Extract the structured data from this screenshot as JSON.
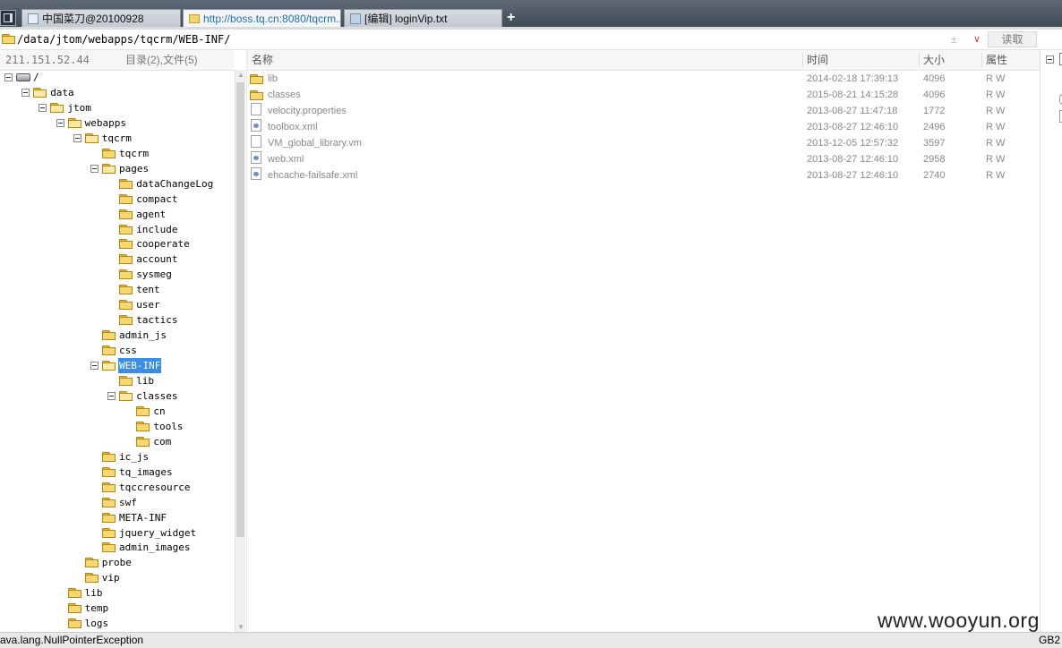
{
  "tabs": [
    {
      "title": "中国菜刀@20100928",
      "icon": "page-icon",
      "active": false
    },
    {
      "title": "http://boss.tq.cn:8080/tqcrm...",
      "icon": "folder-icon",
      "active": true
    },
    {
      "title": "[编辑] loginVip.txt",
      "icon": "document-icon",
      "active": false
    }
  ],
  "new_tab_label": "+",
  "path_bar": {
    "path": "/data/jtom/webapps/tqcrm/WEB-INF/",
    "combo_value": "±",
    "combo_arrow": "∨",
    "read_button": "读取"
  },
  "left_panel": {
    "ip": "211.151.52.44",
    "counts": "目录(2),文件(5)"
  },
  "tree": [
    {
      "label": "/",
      "level": 0,
      "expander": true,
      "icon": "drive"
    },
    {
      "label": "data",
      "level": 1,
      "expander": true,
      "icon": "folder-open"
    },
    {
      "label": "jtom",
      "level": 2,
      "expander": true,
      "icon": "folder-open"
    },
    {
      "label": "webapps",
      "level": 3,
      "expander": true,
      "icon": "folder-open"
    },
    {
      "label": "tqcrm",
      "level": 4,
      "expander": true,
      "icon": "folder-open"
    },
    {
      "label": "tqcrm",
      "level": 5,
      "expander": false,
      "icon": "folder"
    },
    {
      "label": "pages",
      "level": 5,
      "expander": true,
      "icon": "folder-open"
    },
    {
      "label": "dataChangeLog",
      "level": 6,
      "expander": false,
      "icon": "folder"
    },
    {
      "label": "compact",
      "level": 6,
      "expander": false,
      "icon": "folder"
    },
    {
      "label": "agent",
      "level": 6,
      "expander": false,
      "icon": "folder"
    },
    {
      "label": "include",
      "level": 6,
      "expander": false,
      "icon": "folder"
    },
    {
      "label": "cooperate",
      "level": 6,
      "expander": false,
      "icon": "folder"
    },
    {
      "label": "account",
      "level": 6,
      "expander": false,
      "icon": "folder"
    },
    {
      "label": "sysmeg",
      "level": 6,
      "expander": false,
      "icon": "folder"
    },
    {
      "label": "tent",
      "level": 6,
      "expander": false,
      "icon": "folder"
    },
    {
      "label": "user",
      "level": 6,
      "expander": false,
      "icon": "folder"
    },
    {
      "label": "tactics",
      "level": 6,
      "expander": false,
      "icon": "folder"
    },
    {
      "label": "admin_js",
      "level": 5,
      "expander": false,
      "icon": "folder"
    },
    {
      "label": "css",
      "level": 5,
      "expander": false,
      "icon": "folder"
    },
    {
      "label": "WEB-INF",
      "level": 5,
      "expander": true,
      "icon": "folder-open",
      "selected": true
    },
    {
      "label": "lib",
      "level": 6,
      "expander": false,
      "icon": "folder"
    },
    {
      "label": "classes",
      "level": 6,
      "expander": true,
      "icon": "folder-open"
    },
    {
      "label": "cn",
      "level": 7,
      "expander": false,
      "icon": "folder"
    },
    {
      "label": "tools",
      "level": 7,
      "expander": false,
      "icon": "folder"
    },
    {
      "label": "com",
      "level": 7,
      "expander": false,
      "icon": "folder"
    },
    {
      "label": "ic_js",
      "level": 5,
      "expander": false,
      "icon": "folder"
    },
    {
      "label": "tq_images",
      "level": 5,
      "expander": false,
      "icon": "folder"
    },
    {
      "label": "tqccresource",
      "level": 5,
      "expander": false,
      "icon": "folder"
    },
    {
      "label": "swf",
      "level": 5,
      "expander": false,
      "icon": "folder"
    },
    {
      "label": "META-INF",
      "level": 5,
      "expander": false,
      "icon": "folder"
    },
    {
      "label": "jquery_widget",
      "level": 5,
      "expander": false,
      "icon": "folder"
    },
    {
      "label": "admin_images",
      "level": 5,
      "expander": false,
      "icon": "folder"
    },
    {
      "label": "probe",
      "level": 4,
      "expander": false,
      "icon": "folder"
    },
    {
      "label": "vip",
      "level": 4,
      "expander": false,
      "icon": "folder"
    },
    {
      "label": "lib",
      "level": 3,
      "expander": false,
      "icon": "folder"
    },
    {
      "label": "temp",
      "level": 3,
      "expander": false,
      "icon": "folder"
    },
    {
      "label": "logs",
      "level": 3,
      "expander": false,
      "icon": "folder"
    }
  ],
  "columns": {
    "name": "名称",
    "time": "时间",
    "size": "大小",
    "attr": "属性"
  },
  "files": [
    {
      "name": "lib",
      "time": "2014-02-18 17:39:13",
      "size": "4096",
      "attr": "R W",
      "type": "folder"
    },
    {
      "name": "classes",
      "time": "2015-08-21 14:15:28",
      "size": "4096",
      "attr": "R W",
      "type": "folder"
    },
    {
      "name": "velocity.properties",
      "time": "2013-08-27 11:47:18",
      "size": "1772",
      "attr": "R W",
      "type": "file"
    },
    {
      "name": "toolbox.xml",
      "time": "2013-08-27 12:46:10",
      "size": "2496",
      "attr": "R W",
      "type": "xml"
    },
    {
      "name": "VM_global_library.vm",
      "time": "2013-12-05 12:57:32",
      "size": "3597",
      "attr": "R W",
      "type": "file"
    },
    {
      "name": "web.xml",
      "time": "2013-08-27 12:46:10",
      "size": "2958",
      "attr": "R W",
      "type": "xml"
    },
    {
      "name": "ehcache-failsafe.xml",
      "time": "2013-08-27 12:46:10",
      "size": "2740",
      "attr": "R W",
      "type": "xml"
    }
  ],
  "status": {
    "message": "ava.lang.NullPointerException",
    "encoding": "GB2"
  },
  "watermark": "www.wooyun.org",
  "colors": {
    "selection": "#3a8ee6",
    "folder": "#f6d872",
    "active_tab_text": "#1d6fb5"
  }
}
